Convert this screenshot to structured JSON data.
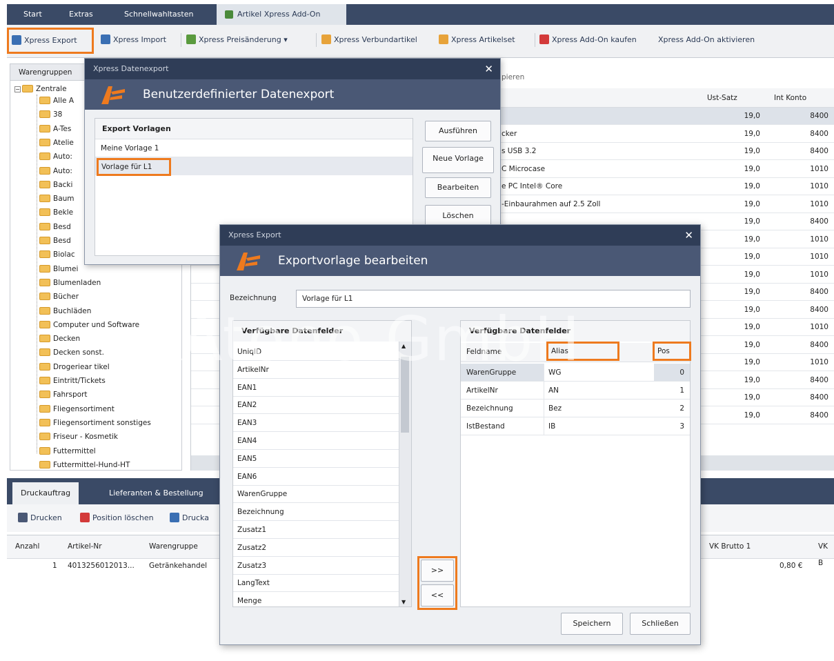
{
  "tabs": [
    "Start",
    "Extras",
    "Schnellwahltasten",
    "Artikel Xpress Add-On"
  ],
  "ribbon": {
    "export": "Xpress Export",
    "import": "Xpress Import",
    "price": "Xpress Preisänderung",
    "verbund": "Xpress Verbundartikel",
    "set": "Xpress Artikelset",
    "buy": "Xpress Add-On kaufen",
    "activate": "Xpress Add-On aktivieren"
  },
  "left": {
    "tab": "Warengruppen",
    "root": "Zentrale",
    "items": [
      "Alle A",
      "38",
      "A-Tes",
      "Atelie",
      "Auto:",
      "Auto:",
      "Backi",
      "Baum",
      "Bekle",
      "Besd",
      "Besd",
      "Biolac",
      "Blumei",
      "Blumenladen",
      "Bücher",
      "Buchläden",
      "Computer und Software",
      "Decken",
      "Decken sonst.",
      "Drogeriear tikel",
      "Eintritt/Tickets",
      "Fahrsport",
      "Fliegensortiment",
      "Fliegensortiment sonstiges",
      "Friseur - Kosmetik",
      "Futtermittel",
      "Futtermittel-Hund-HT"
    ]
  },
  "bg": {
    "search_hint": "pieren",
    "col_ust": "Ust-Satz",
    "col_konto": "Int Konto",
    "rows": [
      {
        "name": "",
        "ust": "19,0",
        "konto": "8400"
      },
      {
        "name": "cker",
        "ust": "19,0",
        "konto": "8400"
      },
      {
        "name": "s USB 3.2",
        "ust": "19,0",
        "konto": "8400"
      },
      {
        "name": "C Microcase",
        "ust": "19,0",
        "konto": "1010"
      },
      {
        "name": "e PC Intel® Core",
        "ust": "19,0",
        "konto": "1010"
      },
      {
        "name": "-Einbaurahmen auf 2.5 Zoll",
        "ust": "19,0",
        "konto": "1010"
      },
      {
        "name": "",
        "ust": "19,0",
        "konto": "8400"
      },
      {
        "name": "",
        "ust": "19,0",
        "konto": "1010"
      },
      {
        "name": "",
        "ust": "19,0",
        "konto": "1010"
      },
      {
        "name": "",
        "ust": "19,0",
        "konto": "1010"
      },
      {
        "name": "",
        "ust": "19,0",
        "konto": "8400"
      },
      {
        "name": "",
        "ust": "19,0",
        "konto": "8400"
      },
      {
        "name": "",
        "ust": "19,0",
        "konto": "1010"
      },
      {
        "name": "",
        "ust": "19,0",
        "konto": "8400"
      },
      {
        "name": "",
        "ust": "19,0",
        "konto": "1010"
      },
      {
        "name": "",
        "ust": "19,0",
        "konto": "8400"
      },
      {
        "name": "",
        "ust": "19,0",
        "konto": "8400"
      },
      {
        "name": "",
        "ust": "19,0",
        "konto": "8400"
      }
    ]
  },
  "bottom": {
    "tab1": "Druckauftrag",
    "tab2": "Lieferanten & Bestellung",
    "print": "Drucken",
    "delete": "Position löschen",
    "druck2": "Drucka",
    "cols": [
      "Anzahl",
      "Artikel-Nr",
      "Warengruppe",
      "VK Brutto 1",
      "VK B"
    ],
    "row": {
      "anzahl": "1",
      "artnr": "4013256012013...",
      "wg": "Getränkehandel",
      "vk": "0,80 €"
    }
  },
  "dlg1": {
    "title": "Xpress Datenexport",
    "heading": "Benutzerdefinierter Datenexport",
    "list_header": "Export Vorlagen",
    "items": [
      "Meine Vorlage 1",
      "Vorlage für L1"
    ],
    "btn_run": "Ausführen",
    "btn_new": "Neue Vorlage",
    "btn_edit": "Bearbeiten",
    "btn_delete": "Löschen"
  },
  "dlg2": {
    "title": "Xpress Export",
    "heading": "Exportvorlage bearbeiten",
    "name_label": "Bezeichnung",
    "name_value": "Vorlage für L1",
    "left_header": "Verfügbare Datenfelder",
    "fields": [
      "UniqID",
      "ArtikelNr",
      "EAN1",
      "EAN2",
      "EAN3",
      "EAN4",
      "EAN5",
      "EAN6",
      "WarenGruppe",
      "Bezeichnung",
      "Zusatz1",
      "Zusatz2",
      "Zusatz3",
      "LangText",
      "Menge"
    ],
    "right_header": "Verfügbare Datenfelder",
    "col_field": "Feldname",
    "col_alias": "Alias",
    "col_pos": "Pos",
    "selected": [
      {
        "field": "WarenGruppe",
        "alias": "WG",
        "pos": "0"
      },
      {
        "field": "ArtikelNr",
        "alias": "AN",
        "pos": "1"
      },
      {
        "field": "Bezeichnung",
        "alias": "Bez",
        "pos": "2"
      },
      {
        "field": "IstBestand",
        "alias": "IB",
        "pos": "3"
      }
    ],
    "add": ">>",
    "remove": "<<",
    "save": "Speichern",
    "close": "Schließen"
  },
  "watermark": "Atono GmbH",
  "colors": {
    "accent": "#ee7a1e",
    "navy": "#3a4a66",
    "dialog_header": "#4a5875"
  }
}
